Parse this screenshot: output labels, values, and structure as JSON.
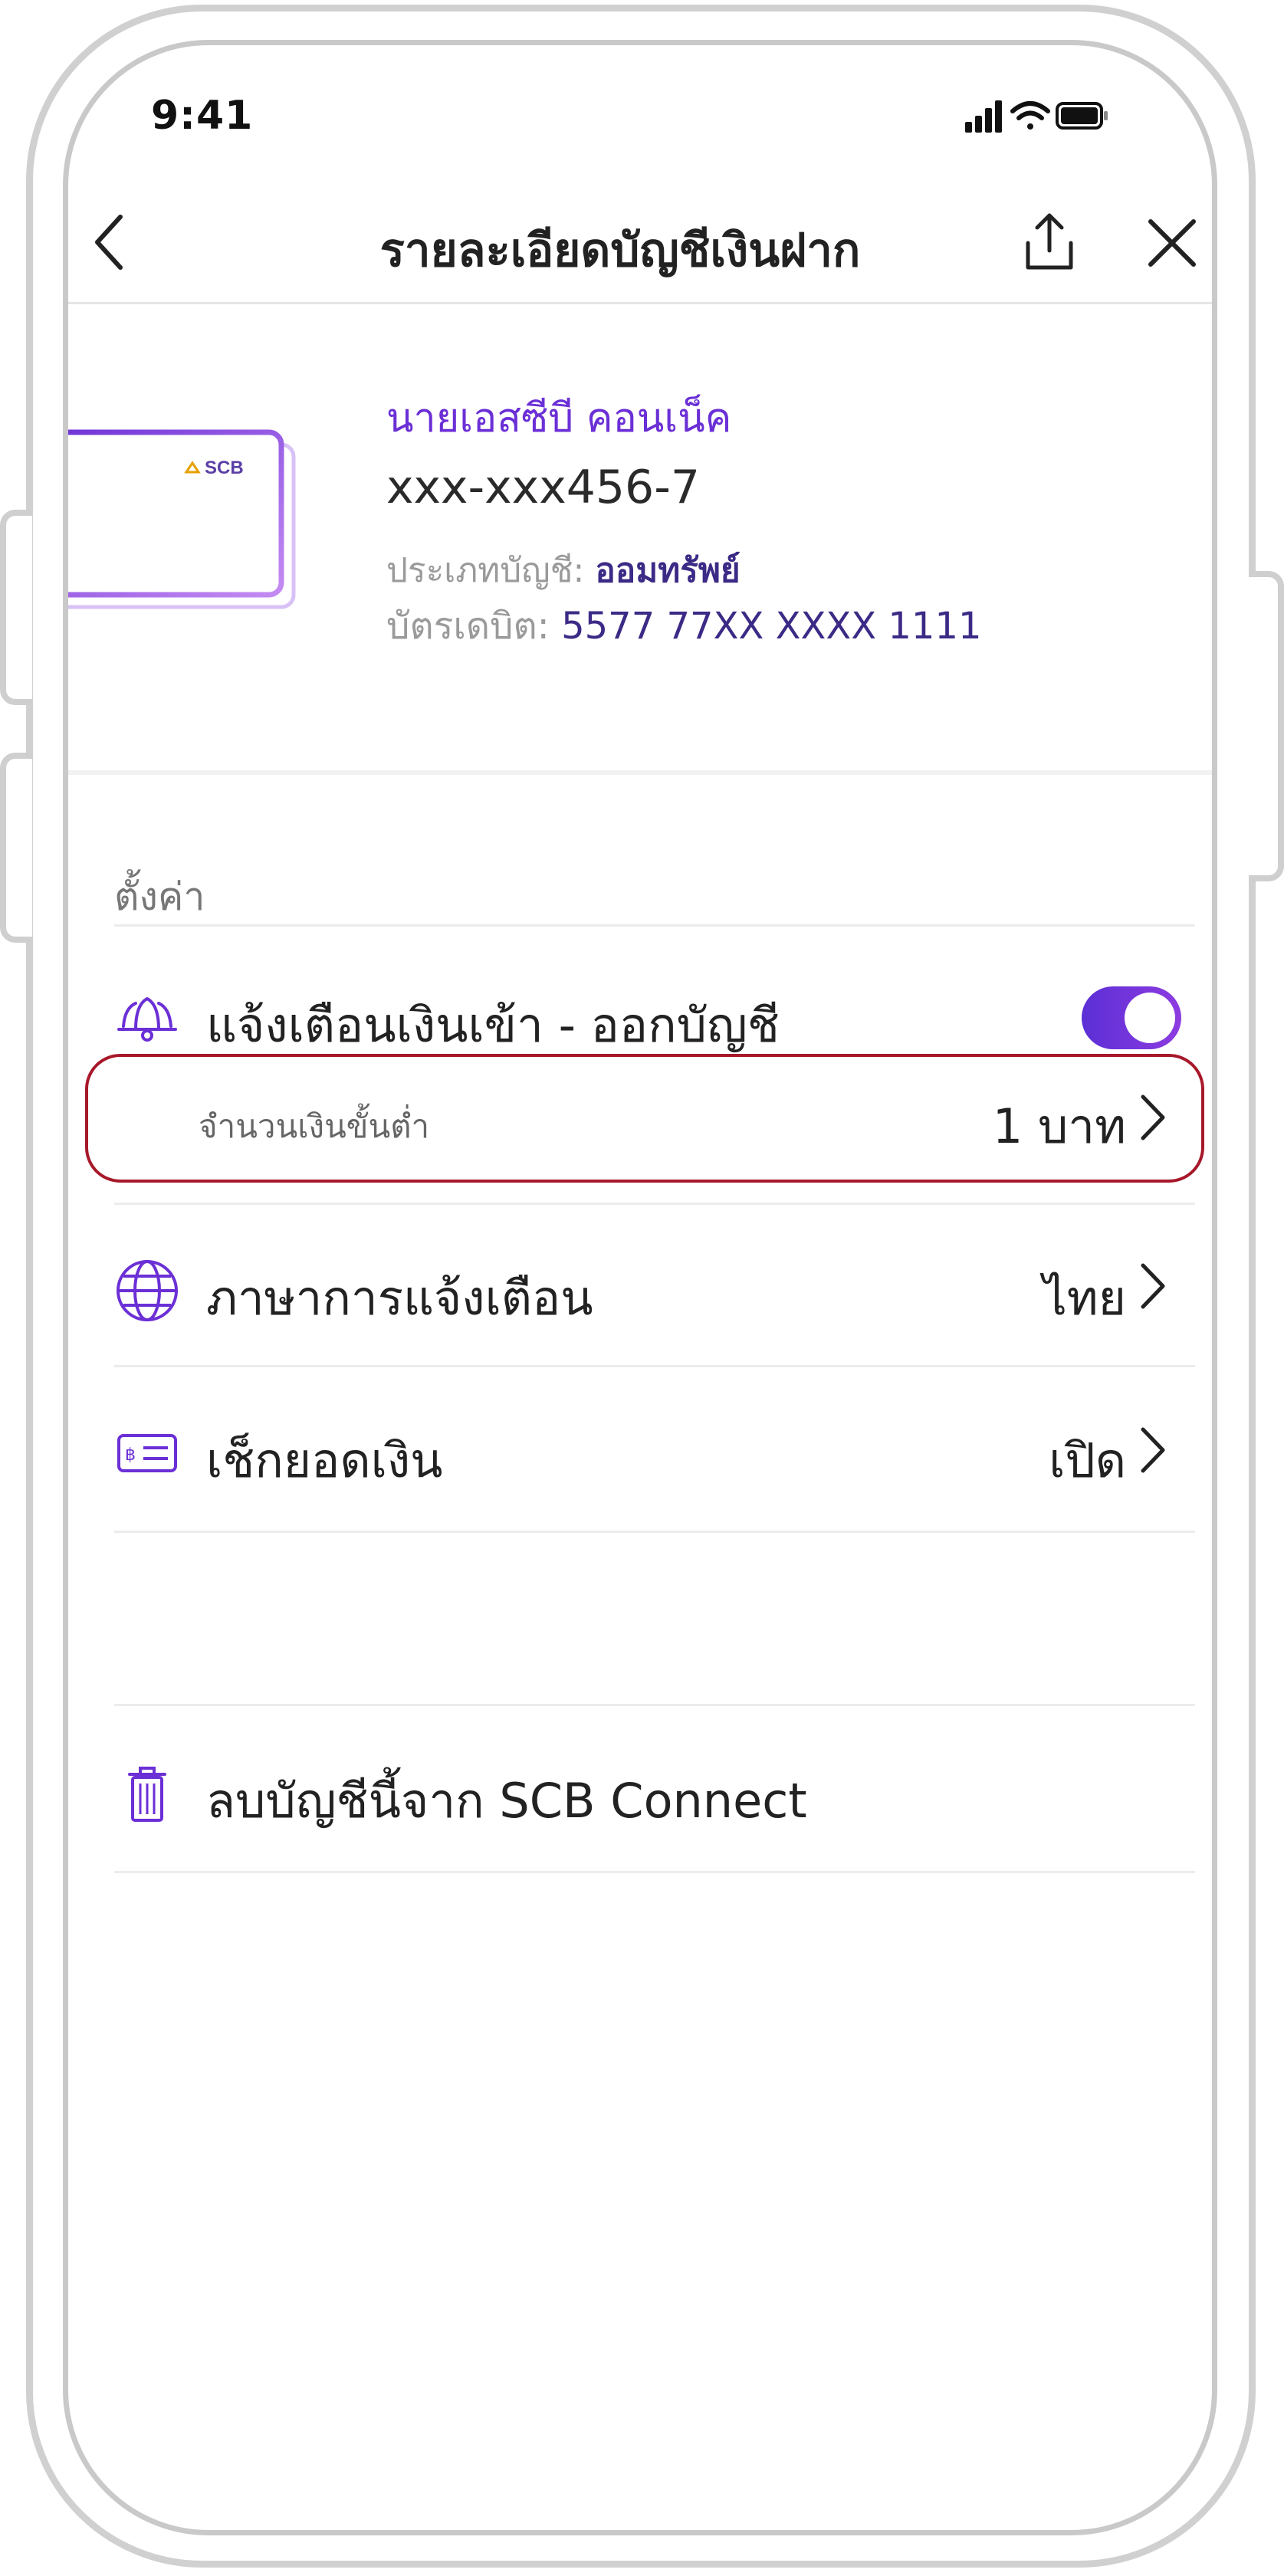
{
  "status_bar": {
    "time": "9:41"
  },
  "header": {
    "title": "รายละเอียดบัญชีเงินฝาก"
  },
  "account": {
    "name": "นายเอสซีบี คอนเน็ค",
    "number": "xxx-xxx456-7",
    "type_label": "ประเภทบัญชี:",
    "type_value": "ออมทรัพย์",
    "debit_label": "บัตรเดบิต:",
    "debit_value": "5577 77XX XXXX 1111",
    "card_brand": "SCB"
  },
  "settings": {
    "section_label": "ตั้งค่า",
    "notification": {
      "label": "แจ้งเตือนเงินเข้า - ออกบัญชี",
      "enabled": true
    },
    "minimum_amount": {
      "label": "จำนวนเงินขั้นต่ำ",
      "value": "1 บาท"
    },
    "language": {
      "label": "ภาษาการแจ้งเตือน",
      "value": "ไทย"
    },
    "balance_check": {
      "label": "เช็กยอดเงิน",
      "value": "เปิด"
    },
    "remove": {
      "label": "ลบบัญชีนี้จาก SCB Connect"
    }
  },
  "colors": {
    "accent": "#6b2fd6",
    "highlight_border": "#a7182a"
  }
}
